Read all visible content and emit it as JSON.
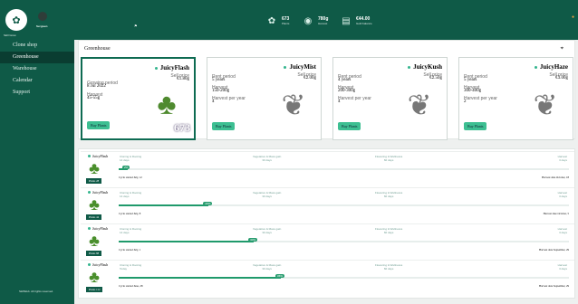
{
  "sidebar": {
    "logo_text": "Skill Grow",
    "user": "Sergwen",
    "menu": [
      "Clone shop",
      "Greenhouse",
      "Warehouse",
      "Calendar",
      "Support"
    ],
    "active": 1,
    "copyright": "SkillWeb. All rights reserved."
  },
  "topbar": {
    "stats": [
      {
        "value": "673",
        "label": "Plants"
      },
      {
        "value": "780g",
        "label": "Harvest"
      },
      {
        "value": "€44.00",
        "label": "Gold balance"
      }
    ]
  },
  "greenhouse": {
    "title": "Greenhouse",
    "cards": [
      {
        "name": "JuicyFlash",
        "price": "€1.80g",
        "period": "3 years",
        "grow_label": "Growing period",
        "grow_date": "8 Jul 2022",
        "harvest_label": "Harvest",
        "harvest": "45-55g",
        "per_year_label": "Harvest per year",
        "per_year": "",
        "count": "673",
        "buy": "Buy Plants",
        "active": true
      },
      {
        "name": "JuicyMist",
        "price": "€2.00g",
        "period": "5 years",
        "grow_label": "Rent period",
        "grow_date": "",
        "harvest_label": "Harvest",
        "harvest": "150-200g",
        "per_year_label": "Harvest per year",
        "per_year": "4",
        "count": "",
        "buy": "Buy Plants",
        "active": false
      },
      {
        "name": "JuicyKush",
        "price": "€2.50g",
        "period": "4 years",
        "grow_label": "Rent period",
        "grow_date": "",
        "harvest_label": "Harvest",
        "harvest": "200-300g",
        "per_year_label": "Harvest per year",
        "per_year": "4",
        "count": "",
        "buy": "Buy Plants",
        "active": false
      },
      {
        "name": "JuicyHaze",
        "price": "€3.00g",
        "period": "5 years",
        "grow_label": "Rent period",
        "grow_date": "",
        "harvest_label": "Harvest",
        "harvest": "300-400g",
        "per_year_label": "Harvest per year",
        "per_year": "2",
        "count": "",
        "buy": "Buy Plants",
        "active": false
      }
    ]
  },
  "cycles": [
    {
      "name": "JuicyFlash",
      "plants": "Plants 28",
      "phase1": "Cloning & Rooting",
      "phase1_days": "14 days",
      "phase2": "Vegetative & Mass gain",
      "phase2_days": "30 days",
      "phase3": "Flowering & Wellnesss",
      "phase3_days": "60 days",
      "harvest": "Harvest",
      "harvest_days": "3 days",
      "pct": "2%",
      "progress": 0.02,
      "start": "Cycle started July, 12",
      "end": "Harvest date October, 18"
    },
    {
      "name": "JuicyFlash",
      "plants": "Plants 44",
      "phase1": "Cloning & Rooting",
      "phase1_days": "14 days",
      "phase2": "Vegetative & Mass gain",
      "phase2_days": "30 days",
      "phase3": "Flowering & Wellnesss",
      "phase3_days": "60 days",
      "harvest": "Harvest",
      "harvest_days": "3 days",
      "pct": "20%",
      "progress": 0.2,
      "start": "Cycle started July, 8",
      "end": "Harvest date October, 5"
    },
    {
      "name": "JuicyFlash",
      "plants": "Plants 88",
      "phase1": "Cloning & Rooting",
      "phase1_days": "14 days",
      "phase2": "Vegetative & Mass gain",
      "phase2_days": "30 days",
      "phase3": "Flowering & Wellnesss",
      "phase3_days": "60 days",
      "harvest": "Harvest",
      "harvest_days": "3 days",
      "pct": "30%",
      "progress": 0.3,
      "start": "Cycle started July, 1",
      "end": "Harvest date September, 29"
    },
    {
      "name": "JuicyFlash",
      "plants": "Plants 112",
      "phase1": "Cloning & Rooting",
      "phase1_days": "Today",
      "phase2": "Vegetative & Mass gain",
      "phase2_days": "30 days",
      "phase3": "Flowering & Wellnesss",
      "phase3_days": "60 days",
      "harvest": "Harvest",
      "harvest_days": "3 days",
      "pct": "36%",
      "progress": 0.36,
      "start": "Cycle started June, 28",
      "end": "Harvest date September, 29"
    }
  ],
  "icons": [
    "cannabis-leaf-icon",
    "shopping-bag-icon",
    "warehouse-icon",
    "calendar-icon",
    "support-icon",
    "pointer-icon"
  ]
}
